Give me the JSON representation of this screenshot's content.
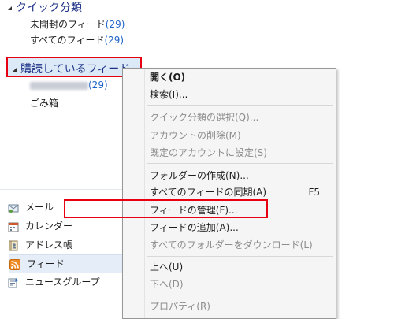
{
  "folders": {
    "quick_views_label": "クイック分類",
    "unread_feeds_label": "未開封のフィード",
    "unread_feeds_count": "(29)",
    "all_feeds_label": "すべてのフィード",
    "all_feeds_count": "(29)",
    "subscribed_label": "購読しているフィード",
    "account_count": "(29)",
    "trash_label": "ごみ箱"
  },
  "nav": {
    "mail": "メール",
    "calendar": "カレンダー",
    "contacts": "アドレス帳",
    "feeds": "フィード",
    "newsgroups": "ニュースグループ"
  },
  "context_menu": {
    "open": "開く(O)",
    "search": "検索(I)...",
    "select_quick_view": "クイック分類の選択(Q)...",
    "delete_account": "アカウントの削除(M)",
    "set_default_account": "既定のアカウントに設定(S)",
    "new_folder": "フォルダーの作成(N)...",
    "sync_all_feeds": "すべてのフィードの同期(A)",
    "sync_all_feeds_shortcut": "F5",
    "manage_feeds": "フィードの管理(F)...",
    "add_feed": "フィードの追加(A)...",
    "download_all_folders": "すべてのフォルダーをダウンロード(L)",
    "move_up": "上へ(U)",
    "move_down": "下へ(D)",
    "properties": "プロパティ(R)"
  },
  "colors": {
    "highlight_border": "#e60012",
    "count_blue": "#1e64c8",
    "header_blue": "#1e3287"
  }
}
